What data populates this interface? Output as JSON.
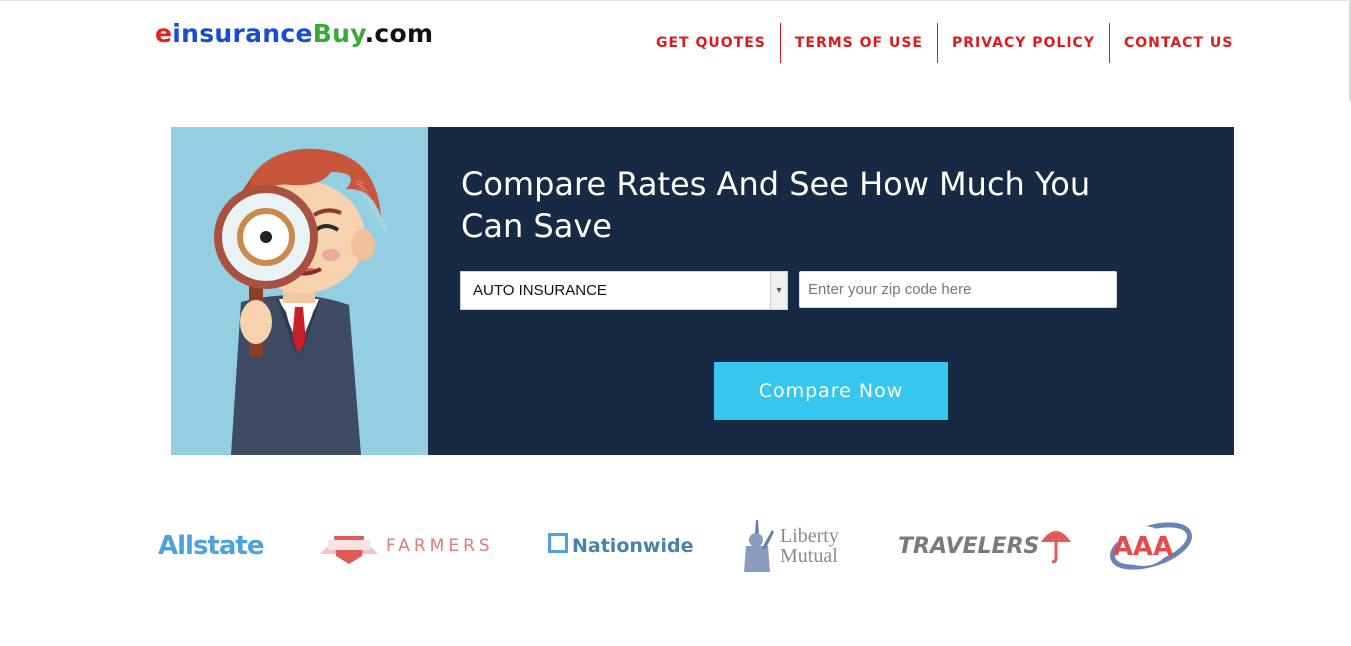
{
  "header": {
    "logo": {
      "part1": "e",
      "part2": "insurance",
      "part3": "Buy",
      "part4": ".com"
    },
    "nav": [
      {
        "label": "GET QUOTES"
      },
      {
        "label": "TERMS OF USE"
      },
      {
        "label": "PRIVACY POLICY"
      },
      {
        "label": "CONTACT US"
      }
    ]
  },
  "hero": {
    "title": "Compare Rates And See How Much You Can Save",
    "select": {
      "value": "AUTO INSURANCE"
    },
    "zip": {
      "placeholder": "Enter your zip code here",
      "value": ""
    },
    "button": "Compare Now",
    "image": "cartoon-man-magnifying-glass"
  },
  "brands": [
    {
      "name": "Allstate",
      "icon": "allstate-logo"
    },
    {
      "name": "FARMERS",
      "icon": "farmers-logo"
    },
    {
      "name": "Nationwide",
      "icon": "nationwide-logo"
    },
    {
      "name": "Liberty",
      "name2": "Mutual",
      "icon": "liberty-mutual-logo"
    },
    {
      "name": "TRAVELERS",
      "icon": "travelers-logo"
    },
    {
      "name": "AAA",
      "icon": "aaa-logo"
    }
  ],
  "colors": {
    "nav": "#e01a1a",
    "hero_bg": "#172a44",
    "button": "#36c6ee",
    "image_bg": "#94cfe1"
  }
}
